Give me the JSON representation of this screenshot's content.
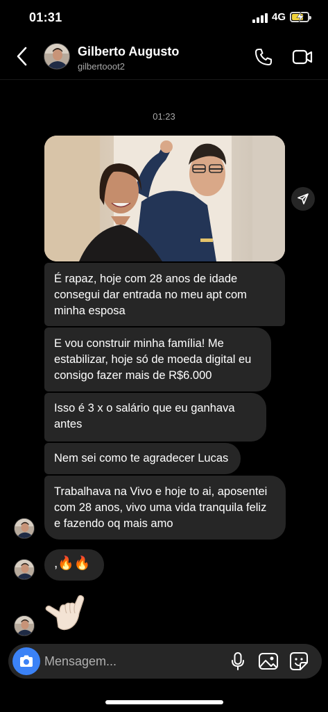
{
  "status_bar": {
    "time": "01:31",
    "network": "4G",
    "icons": [
      "signal-icon",
      "battery-charging-icon"
    ]
  },
  "header": {
    "name": "Gilberto Augusto",
    "username": "gilbertooot2",
    "icons": [
      "back-icon",
      "phone-icon",
      "video-icon"
    ]
  },
  "chat": {
    "timestamp": "01:23",
    "messages": [
      {
        "type": "photo"
      },
      {
        "type": "text",
        "text": "É rapaz, hoje com 28 anos de idade consegui dar entrada no meu apt com minha esposa"
      },
      {
        "type": "text",
        "text": "E vou construir minha família! Me estabilizar, hoje só de moeda digital eu consigo fazer mais de R$6.000"
      },
      {
        "type": "text",
        "text": "Isso é 3 x o salário que eu ganhava antes"
      },
      {
        "type": "text",
        "text": "Nem sei como te agradecer Lucas"
      },
      {
        "type": "text",
        "text": "Trabalhava na Vivo e hoje to ai, aposentei com 28 anos, vivo uma vida tranquila feliz e fazendo oq mais amo"
      },
      {
        "type": "text",
        "text": ",🔥🔥"
      },
      {
        "type": "emoji",
        "icon": "call-me-hand-emoji"
      }
    ]
  },
  "composer": {
    "placeholder": "Mensagem...",
    "icons": [
      "camera-icon",
      "microphone-icon",
      "gallery-icon",
      "sticker-icon"
    ]
  },
  "colors": {
    "background": "#000000",
    "bubble": "#262626",
    "camera_button": "#3b82f6",
    "secondary_text": "#a8a8a8"
  }
}
